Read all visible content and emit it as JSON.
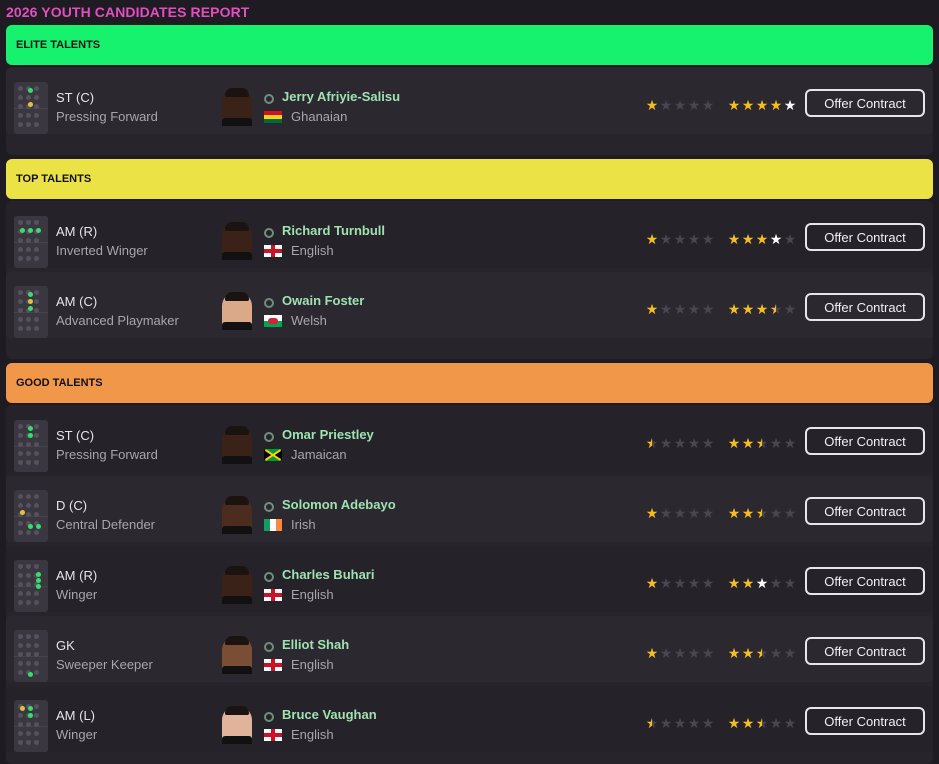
{
  "report": {
    "title": "2026 YOUTH CANDIDATES REPORT"
  },
  "colors": {
    "elite": "#16f26e",
    "top": "#ebe246",
    "good": "#f0974a",
    "title": "#e24fbf",
    "name": "#9ee2b0",
    "star": "#f7bf1c"
  },
  "sections": [
    {
      "label": "ELITE TALENTS"
    },
    {
      "label": "TOP TALENTS"
    },
    {
      "label": "GOOD TALENTS"
    }
  ],
  "players": [
    {
      "position": "ST (C)",
      "role": "Pressing Forward",
      "name": "Jerry Afriyie-Salisu",
      "nationality": "Ghanaian",
      "flag": "ghana-flag",
      "current_ability_stars": 1,
      "potential_ability_stars": 5,
      "offer_label": "Offer Contract"
    },
    {
      "position": "AM (R)",
      "role": "Inverted Winger",
      "name": "Richard Turnbull",
      "nationality": "English",
      "flag": "england-flag",
      "current_ability_stars": 1,
      "potential_ability_stars": 4,
      "offer_label": "Offer Contract"
    },
    {
      "position": "AM (C)",
      "role": "Advanced Playmaker",
      "name": "Owain Foster",
      "nationality": "Welsh",
      "flag": "wales-flag",
      "current_ability_stars": 1,
      "potential_ability_stars": 3.5,
      "offer_label": "Offer Contract"
    },
    {
      "position": "ST (C)",
      "role": "Pressing Forward",
      "name": "Omar Priestley",
      "nationality": "Jamaican",
      "flag": "jamaica-flag",
      "current_ability_stars": 0.5,
      "potential_ability_stars": 2.5,
      "offer_label": "Offer Contract"
    },
    {
      "position": "D (C)",
      "role": "Central Defender",
      "name": "Solomon Adebayo",
      "nationality": "Irish",
      "flag": "ireland-flag",
      "current_ability_stars": 1,
      "potential_ability_stars": 2.5,
      "offer_label": "Offer Contract"
    },
    {
      "position": "AM (R)",
      "role": "Winger",
      "name": "Charles Buhari",
      "nationality": "English",
      "flag": "england-flag",
      "current_ability_stars": 1,
      "potential_ability_stars": 3,
      "offer_label": "Offer Contract"
    },
    {
      "position": "GK",
      "role": "Sweeper Keeper",
      "name": "Elliot Shah",
      "nationality": "English",
      "flag": "england-flag",
      "current_ability_stars": 1,
      "potential_ability_stars": 2.5,
      "offer_label": "Offer Contract"
    },
    {
      "position": "AM (L)",
      "role": "Winger",
      "name": "Bruce Vaughan",
      "nationality": "English",
      "flag": "england-flag",
      "current_ability_stars": 0.5,
      "potential_ability_stars": 2.5,
      "offer_label": "Offer Contract"
    }
  ]
}
